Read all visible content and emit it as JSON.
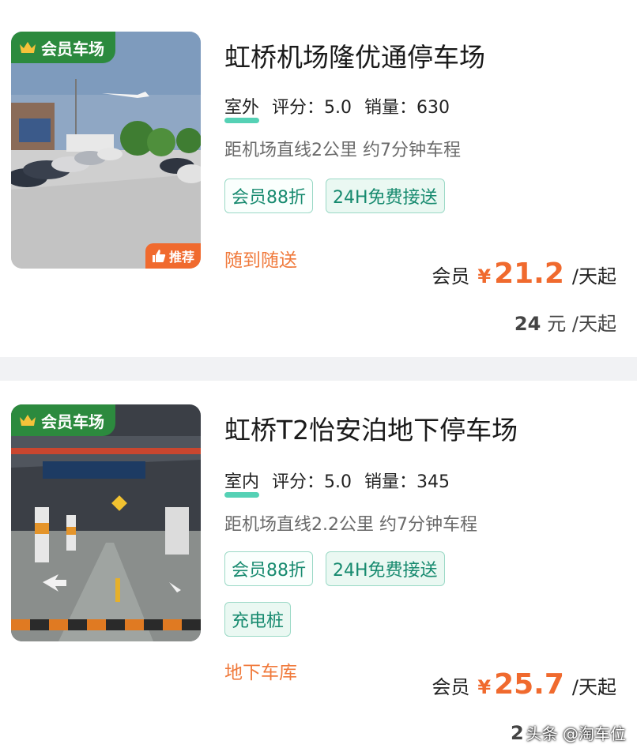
{
  "listings": [
    {
      "badge": "会员车场",
      "recommend": "推荐",
      "title": "虹桥机场隆优通停车场",
      "place": "室外",
      "rating_label": "评分：5.0",
      "sales_label": "销量：630",
      "distance": "距机场直线2公里 约7分钟车程",
      "tags": [
        "会员88折",
        "24H免费接送"
      ],
      "delivery": "随到随送",
      "member_label": "会员",
      "currency": "¥",
      "member_price": "21.2",
      "unit": "/天起",
      "orig_price": "24",
      "orig_unit": "元 /天起"
    },
    {
      "badge": "会员车场",
      "title": "虹桥T2怡安泊地下停车场",
      "place": "室内",
      "rating_label": "评分：5.0",
      "sales_label": "销量：345",
      "distance": "距机场直线2.2公里 约7分钟车程",
      "tags": [
        "会员88折",
        "24H免费接送"
      ],
      "tag_extra": "充电桩",
      "delivery": "地下车库",
      "member_label": "会员",
      "currency": "¥",
      "member_price": "25.7",
      "unit": "/天起",
      "orig_price_partial": "2"
    }
  ],
  "watermark": "头条 @淘车位",
  "colors": {
    "accent": "#f06a2e",
    "badge_green": "#2c8a3e",
    "tag_text": "#178a6f"
  }
}
